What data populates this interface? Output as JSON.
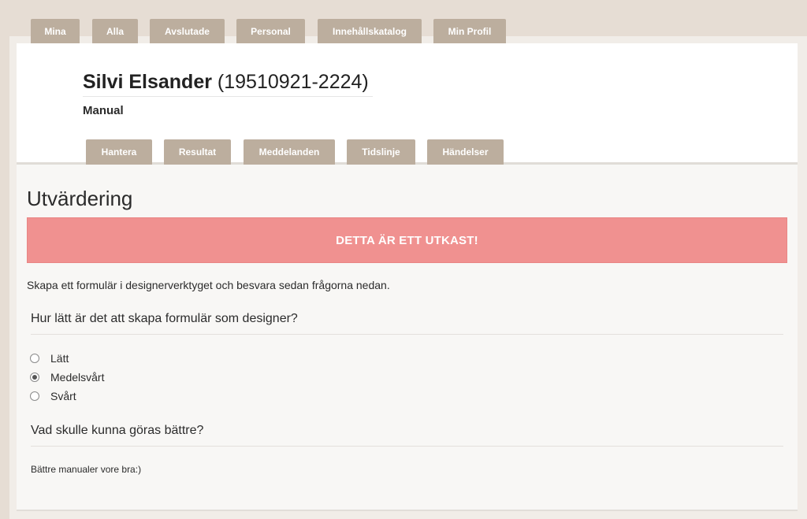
{
  "top_nav": {
    "tabs": [
      {
        "label": "Mina"
      },
      {
        "label": "Alla"
      },
      {
        "label": "Avslutade"
      },
      {
        "label": "Personal"
      },
      {
        "label": "Innehållskatalog"
      },
      {
        "label": "Min Profil"
      }
    ]
  },
  "person": {
    "name": "Silvi Elsander",
    "ssn": "(19510921-2224)",
    "role": "Manual"
  },
  "sub_nav": {
    "tabs": [
      {
        "label": "Hantera"
      },
      {
        "label": "Resultat"
      },
      {
        "label": "Meddelanden"
      },
      {
        "label": "Tidslinje"
      },
      {
        "label": "Händelser"
      }
    ]
  },
  "evaluation": {
    "title": "Utvärdering",
    "draft_banner": "DETTA ÄR ETT UTKAST!",
    "instructions": "Skapa ett formulär i designerverktyget och besvara sedan frågorna nedan.",
    "question1": {
      "text": "Hur lätt är det att skapa formulär som designer?",
      "options": [
        {
          "label": "Lätt",
          "selected": false
        },
        {
          "label": "Medelsvårt",
          "selected": true
        },
        {
          "label": "Svårt",
          "selected": false
        }
      ]
    },
    "question2": {
      "text": "Vad skulle kunna göras bättre?",
      "answer": "Bättre manualer vore bra:)"
    }
  },
  "colors": {
    "tab_bg": "#bcae9e",
    "draft_banner_bg": "#f09190",
    "page_bg": "#e6ddd4"
  }
}
